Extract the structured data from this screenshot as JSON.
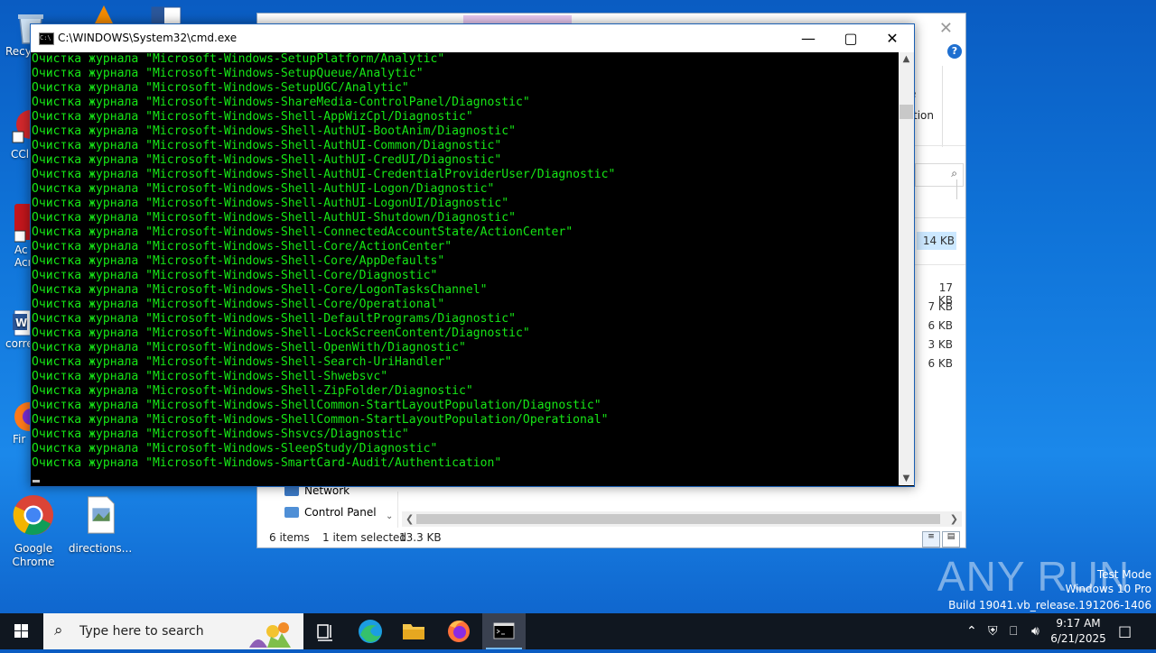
{
  "desktop": {
    "icons": [
      {
        "label": "Google Chrome"
      },
      {
        "label": "directions..."
      }
    ],
    "partial_labels": [
      "Recy",
      "CCl",
      "Ac",
      "Acr",
      "corre",
      "Fir"
    ]
  },
  "explorer": {
    "right_labels": [
      "e",
      "tion"
    ],
    "sizes": [
      "14 KB",
      "17 KB",
      "7 KB",
      "6 KB",
      "3 KB",
      "6 KB"
    ],
    "nav_items": [
      {
        "label": "Network"
      },
      {
        "label": "Control Panel"
      }
    ],
    "status": {
      "items": "6 items",
      "selected": "1 item selected",
      "size": "13.3 KB"
    }
  },
  "cmd": {
    "title": "C:\\WINDOWS\\System32\\cmd.exe",
    "lines": [
      "Очистка журнала \"Microsoft-Windows-SetupPlatform/Analytic\"",
      "Очистка журнала \"Microsoft-Windows-SetupQueue/Analytic\"",
      "Очистка журнала \"Microsoft-Windows-SetupUGC/Analytic\"",
      "Очистка журнала \"Microsoft-Windows-ShareMedia-ControlPanel/Diagnostic\"",
      "Очистка журнала \"Microsoft-Windows-Shell-AppWizCpl/Diagnostic\"",
      "Очистка журнала \"Microsoft-Windows-Shell-AuthUI-BootAnim/Diagnostic\"",
      "Очистка журнала \"Microsoft-Windows-Shell-AuthUI-Common/Diagnostic\"",
      "Очистка журнала \"Microsoft-Windows-Shell-AuthUI-CredUI/Diagnostic\"",
      "Очистка журнала \"Microsoft-Windows-Shell-AuthUI-CredentialProviderUser/Diagnostic\"",
      "Очистка журнала \"Microsoft-Windows-Shell-AuthUI-Logon/Diagnostic\"",
      "Очистка журнала \"Microsoft-Windows-Shell-AuthUI-LogonUI/Diagnostic\"",
      "Очистка журнала \"Microsoft-Windows-Shell-AuthUI-Shutdown/Diagnostic\"",
      "Очистка журнала \"Microsoft-Windows-Shell-ConnectedAccountState/ActionCenter\"",
      "Очистка журнала \"Microsoft-Windows-Shell-Core/ActionCenter\"",
      "Очистка журнала \"Microsoft-Windows-Shell-Core/AppDefaults\"",
      "Очистка журнала \"Microsoft-Windows-Shell-Core/Diagnostic\"",
      "Очистка журнала \"Microsoft-Windows-Shell-Core/LogonTasksChannel\"",
      "Очистка журнала \"Microsoft-Windows-Shell-Core/Operational\"",
      "Очистка журнала \"Microsoft-Windows-Shell-DefaultPrograms/Diagnostic\"",
      "Очистка журнала \"Microsoft-Windows-Shell-LockScreenContent/Diagnostic\"",
      "Очистка журнала \"Microsoft-Windows-Shell-OpenWith/Diagnostic\"",
      "Очистка журнала \"Microsoft-Windows-Shell-Search-UriHandler\"",
      "Очистка журнала \"Microsoft-Windows-Shell-Shwebsvc\"",
      "Очистка журнала \"Microsoft-Windows-Shell-ZipFolder/Diagnostic\"",
      "Очистка журнала \"Microsoft-Windows-ShellCommon-StartLayoutPopulation/Diagnostic\"",
      "Очистка журнала \"Microsoft-Windows-ShellCommon-StartLayoutPopulation/Operational\"",
      "Очистка журнала \"Microsoft-Windows-Shsvcs/Diagnostic\"",
      "Очистка журнала \"Microsoft-Windows-SleepStudy/Diagnostic\"",
      "Очистка журнала \"Microsoft-Windows-SmartCard-Audit/Authentication\""
    ],
    "text_color": "#16e616"
  },
  "watermark": {
    "logo": "ANY RUN",
    "line1": "Test Mode",
    "line2": "Windows 10 Pro",
    "line3": "Build 19041.vb_release.191206-1406"
  },
  "taskbar": {
    "search_placeholder": "Type here to search",
    "apps": [
      "task-view",
      "edge",
      "file-explorer",
      "firefox",
      "cmd"
    ],
    "time": "9:17 AM",
    "date": "6/21/2025"
  }
}
